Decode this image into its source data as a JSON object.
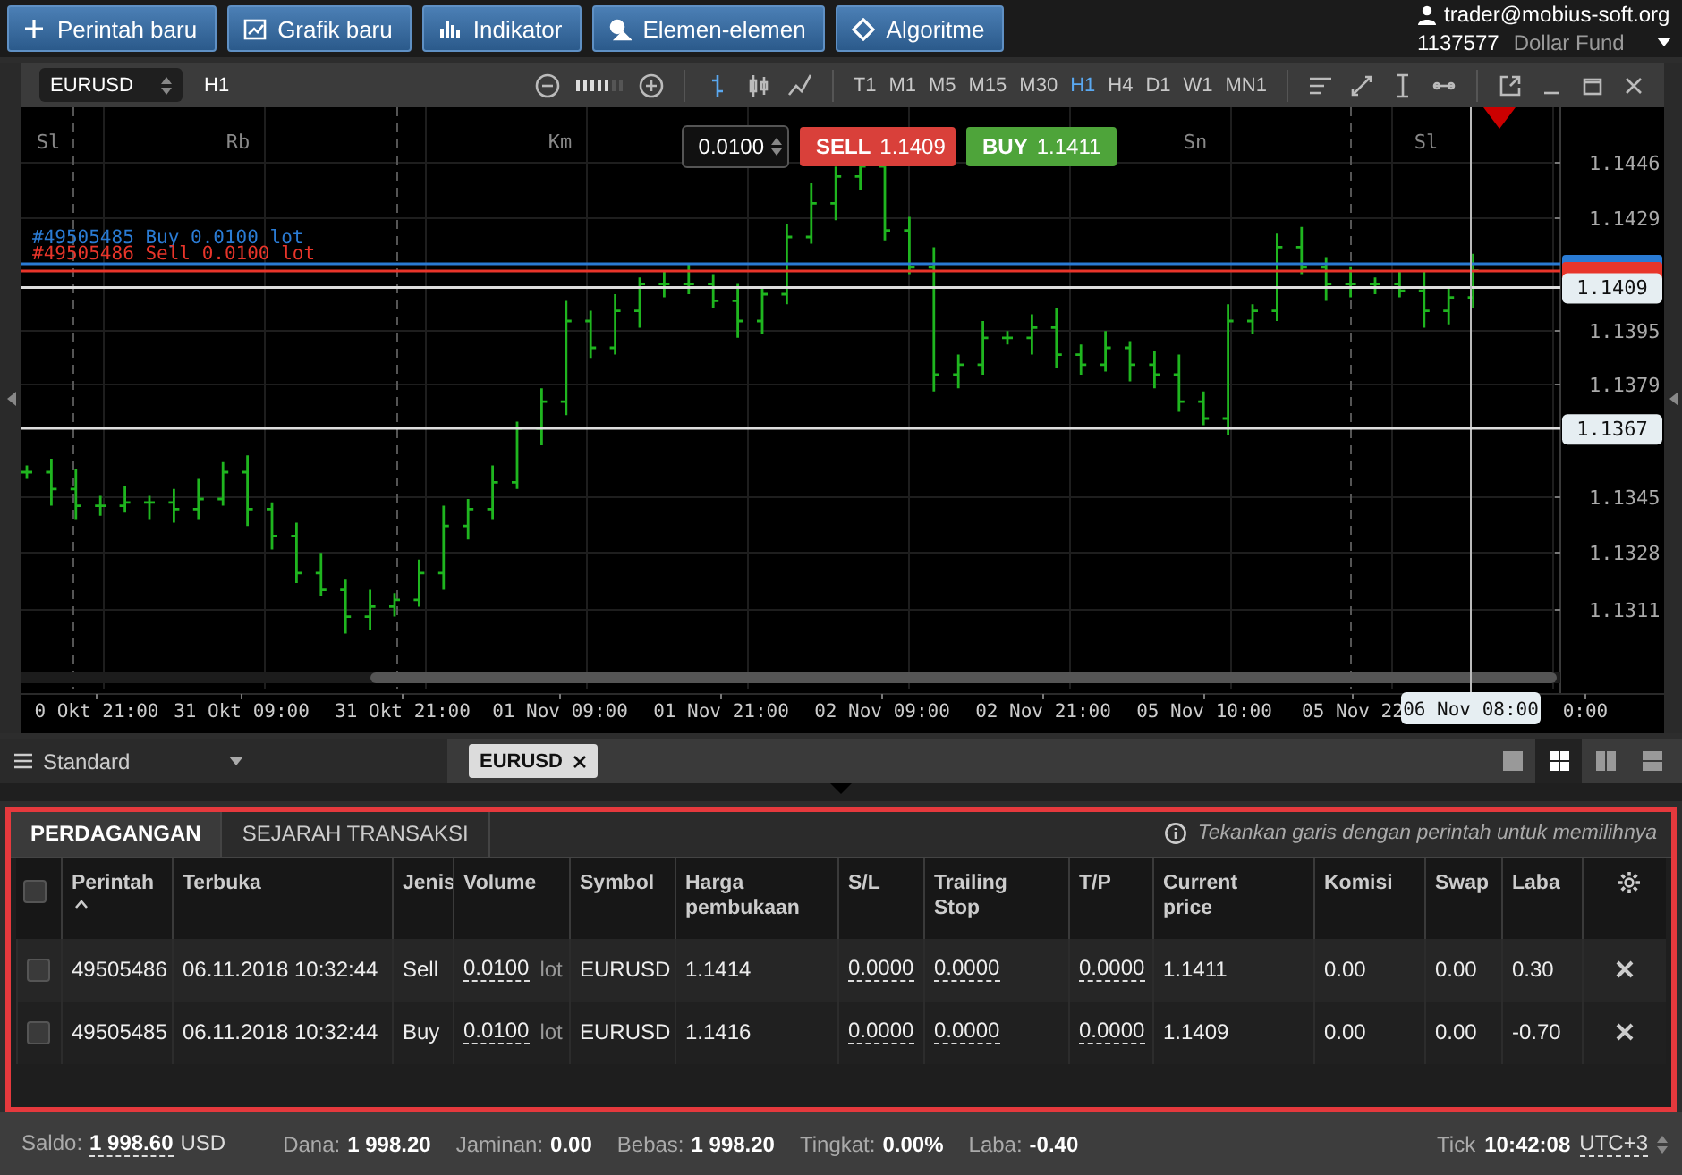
{
  "toolbar": {
    "buttons": [
      {
        "kind": "new_order",
        "label": "Perintah baru"
      },
      {
        "kind": "new_chart",
        "label": "Grafik baru"
      },
      {
        "kind": "indicator",
        "label": "Indikator"
      },
      {
        "kind": "elements",
        "label": "Elemen-elemen"
      },
      {
        "kind": "algorithm",
        "label": "Algoritme"
      }
    ]
  },
  "account": {
    "user": "trader@mobius-soft.org",
    "number": "1137577",
    "name": "Dollar Fund"
  },
  "chart_window": {
    "symbol": "EURUSD",
    "period": "H1",
    "zoom": {
      "level": 0.7
    },
    "chart_types": [
      {
        "kind": "bars",
        "selected": true
      },
      {
        "kind": "candles",
        "selected": false
      },
      {
        "kind": "line",
        "selected": false
      }
    ],
    "timeframes": [
      {
        "label": "T1",
        "selected": false
      },
      {
        "label": "M1",
        "selected": false
      },
      {
        "label": "M5",
        "selected": false
      },
      {
        "label": "M15",
        "selected": false
      },
      {
        "label": "M30",
        "selected": false
      },
      {
        "label": "H1",
        "selected": true
      },
      {
        "label": "H4",
        "selected": false
      },
      {
        "label": "D1",
        "selected": false
      },
      {
        "label": "W1",
        "selected": false
      },
      {
        "label": "MN1",
        "selected": false
      }
    ],
    "lot": "0.0100",
    "sell": {
      "label": "SELL",
      "price": "1.1409"
    },
    "buy": {
      "label": "BUY",
      "price": "1.1411"
    },
    "chart": {
      "day_labels": [
        "Sl",
        "Rb",
        "Km",
        "Sn",
        "Sl"
      ],
      "price_axis": [
        "1.1446",
        "1.1429",
        "1.1395",
        "1.1379",
        "1.1345",
        "1.1328",
        "1.1311"
      ],
      "time_axis": [
        "0 Okt 21:00",
        "31 Okt 09:00",
        "31 Okt 21:00",
        "01 Nov 09:00",
        "01 Nov 21:00",
        "02 Nov 09:00",
        "02 Nov 21:00",
        "05 Nov 10:00",
        "05 Nov 22",
        "0:00"
      ],
      "orders": [
        {
          "label": "#49505485 Buy 0.0100 lot",
          "color": "#2a7bd4"
        },
        {
          "label": "#49505486 Sell 0.0100 lot",
          "color": "#e8352a"
        }
      ],
      "current_price": "1.1409",
      "crosshair": {
        "price": "1.1367",
        "time": "06 Nov 08:00"
      }
    }
  },
  "workspace": {
    "layout_name": "Standard",
    "tabs": [
      {
        "label": "EURUSD",
        "selected": true
      }
    ],
    "layouts": [
      {
        "kind": "single",
        "selected": false
      },
      {
        "kind": "grid",
        "selected": true
      },
      {
        "kind": "columns",
        "selected": false
      },
      {
        "kind": "rows",
        "selected": false
      }
    ]
  },
  "trade_panel": {
    "tabs": [
      {
        "label": "PERDAGANGAN",
        "selected": true
      },
      {
        "label": "SEJARAH TRANSAKSI",
        "selected": false
      }
    ],
    "hint": "Tekankan garis dengan perintah untuk memilihnya",
    "select_all": {
      "checked": false
    },
    "columns": [
      {
        "label": "Perintah",
        "sorted": true
      },
      {
        "label": "Terbuka",
        "sorted": false
      },
      {
        "label": "Jenis",
        "sorted": false
      },
      {
        "label": "Volume",
        "sorted": false
      },
      {
        "label": "Symbol",
        "sorted": false
      },
      {
        "label": "Harga pembukaan",
        "sorted": false
      },
      {
        "label": "S/L",
        "sorted": false
      },
      {
        "label": "Trailing Stop",
        "sorted": false
      },
      {
        "label": "T/P",
        "sorted": false
      },
      {
        "label": "Current price",
        "sorted": false
      },
      {
        "label": "Komisi",
        "sorted": false
      },
      {
        "label": "Swap",
        "sorted": false
      },
      {
        "label": "Laba",
        "sorted": false
      }
    ],
    "rows": [
      {
        "checked": false,
        "order": "49505486",
        "opened": "06.11.2018 10:32:44",
        "type": "Sell",
        "volume": "0.0100",
        "unit": "lot",
        "symbol": "EURUSD",
        "open_price": "1.1414",
        "sl": "0.0000",
        "trailing_stop": "0.0000",
        "tp": "0.0000",
        "current_price": "1.1411",
        "commission": "0.00",
        "swap": "0.00",
        "profit": "0.30"
      },
      {
        "checked": false,
        "order": "49505485",
        "opened": "06.11.2018 10:32:44",
        "type": "Buy",
        "volume": "0.0100",
        "unit": "lot",
        "symbol": "EURUSD",
        "open_price": "1.1416",
        "sl": "0.0000",
        "trailing_stop": "0.0000",
        "tp": "0.0000",
        "current_price": "1.1409",
        "commission": "0.00",
        "swap": "0.00",
        "profit": "-0.70"
      }
    ]
  },
  "status_bar": {
    "items": [
      {
        "kind": "editable",
        "label": "Saldo:",
        "value": "1 998.60",
        "unit": "USD"
      },
      {
        "kind": "plain",
        "label": "Dana:",
        "value": "1 998.20"
      },
      {
        "kind": "plain",
        "label": "Jaminan:",
        "value": "0.00"
      },
      {
        "kind": "plain",
        "label": "Bebas:",
        "value": "1 998.20"
      },
      {
        "kind": "plain",
        "label": "Tingkat:",
        "value": "0.00%"
      },
      {
        "kind": "plain",
        "label": "Laba:",
        "value": "-0.40"
      }
    ],
    "tick_label": "Tick",
    "time": "10:42:08",
    "timezone": "UTC+3"
  }
}
